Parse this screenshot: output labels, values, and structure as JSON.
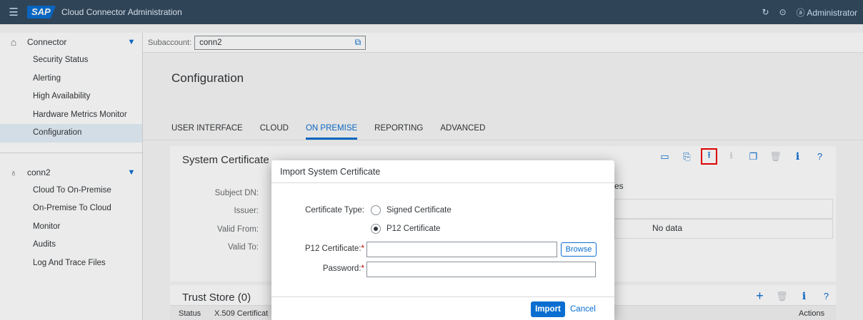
{
  "shell": {
    "logo": "SAP",
    "title": "Cloud Connector Administration",
    "refresh_icon": "refresh-icon",
    "logout_icon": "logout-icon",
    "user": "Administrator"
  },
  "sidebar": {
    "group1": {
      "label": "Connector",
      "icon": "home-icon",
      "items": [
        "Security Status",
        "Alerting",
        "High Availability",
        "Hardware Metrics Monitor",
        "Configuration"
      ],
      "active": "Configuration"
    },
    "group2": {
      "label": "conn2",
      "icon": "subaccount-icon",
      "items": [
        "Cloud To On-Premise",
        "On-Premise To Cloud",
        "Monitor",
        "Audits",
        "Log And Trace Files"
      ]
    }
  },
  "subaccount": {
    "label": "Subaccount:",
    "value": "conn2"
  },
  "page": {
    "title": "Configuration",
    "tabs": [
      "USER INTERFACE",
      "CLOUD",
      "ON PREMISE",
      "REPORTING",
      "ADVANCED"
    ],
    "active_tab": "ON PREMISE"
  },
  "system_certificate": {
    "title": "System Certificate",
    "labels": [
      "Subject DN:",
      "Issuer:",
      "Valid From:",
      "Valid To:"
    ],
    "right_header_fragment": "es",
    "no_data": "No data",
    "toolbar": [
      "create-csr-icon",
      "generate-icon",
      "upload-icon",
      "download-icon",
      "copy-icon",
      "delete-icon",
      "info-icon",
      "help-icon"
    ]
  },
  "trust_store": {
    "title": "Trust Store  (0)",
    "columns": [
      "Status",
      "X.509 Certificat",
      "Actions"
    ]
  },
  "dialog": {
    "title": "Import System Certificate",
    "certificate_type_label": "Certificate Type:",
    "options": [
      "Signed Certificate",
      "P12 Certificate"
    ],
    "selected_option": "P12 Certificate",
    "p12_label": "P12 Certificate:",
    "p12_value": "",
    "browse_label": "Browse",
    "password_label": "Password:",
    "password_value": "",
    "import_label": "Import",
    "cancel_label": "Cancel"
  },
  "colors": {
    "shell": "#354a5f",
    "accent": "#0a6ed1",
    "required": "#bb0000",
    "highlight": "#e00000"
  }
}
